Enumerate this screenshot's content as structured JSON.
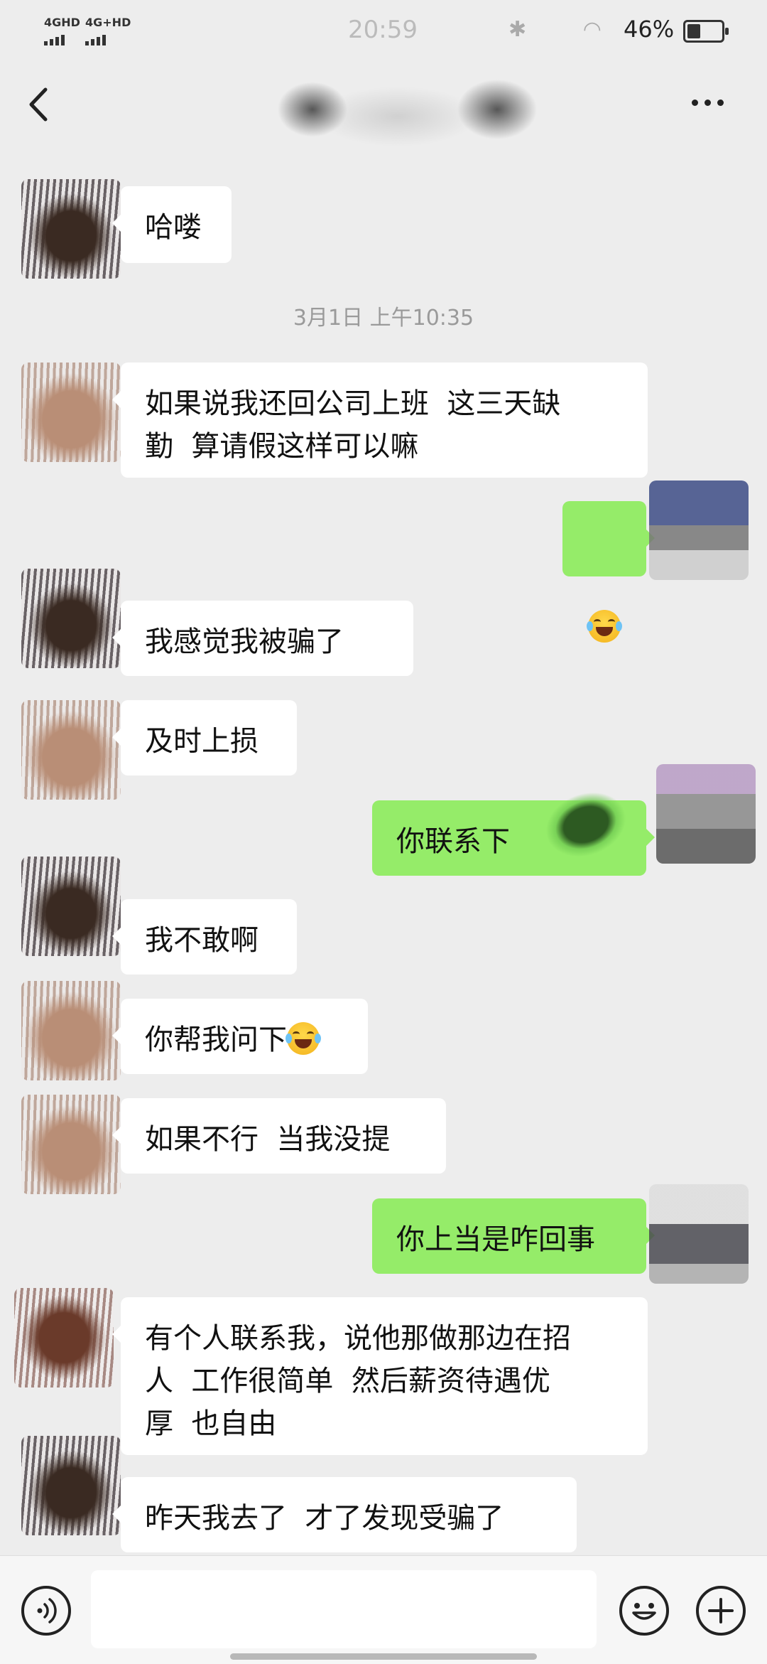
{
  "status_bar": {
    "network1": "4GHD",
    "network2": "4G+HD",
    "time": "20:59",
    "battery_percent": "46%",
    "battery_level": 0.46
  },
  "chat": {
    "timestamp": "3月1日 上午10:35",
    "messages": [
      {
        "side": "in",
        "text": "哈喽"
      },
      {
        "side": "in",
        "text": "如果说我还回公司上班  这三天缺\n勤  算请假这样可以嘛"
      },
      {
        "side": "out",
        "emoji": "crying-laughing-emoji"
      },
      {
        "side": "in",
        "text": "我感觉我被骗了"
      },
      {
        "side": "in",
        "text": "及时上损"
      },
      {
        "side": "out",
        "text": "你联系下"
      },
      {
        "side": "in",
        "text": "我不敢啊"
      },
      {
        "side": "in",
        "text": "你帮我问下",
        "emoji": "crying-laughing-emoji"
      },
      {
        "side": "in",
        "text": "如果不行  当我没提"
      },
      {
        "side": "out",
        "text": "你上当是咋回事"
      },
      {
        "side": "in",
        "text": "有个人联系我，说他那做那边在招\n人  工作很简单  然后薪资待遇优\n厚  也自由"
      },
      {
        "side": "in",
        "text": "昨天我去了  才了发现受骗了"
      }
    ]
  },
  "colors": {
    "background": "#ededed",
    "incoming_bubble": "#ffffff",
    "outgoing_bubble": "#95ec69"
  },
  "icons": {
    "back": "back-arrow-icon",
    "more": "more-dots-icon",
    "voice": "voice-icon",
    "emoji": "emoji-icon",
    "plus": "plus-icon"
  }
}
